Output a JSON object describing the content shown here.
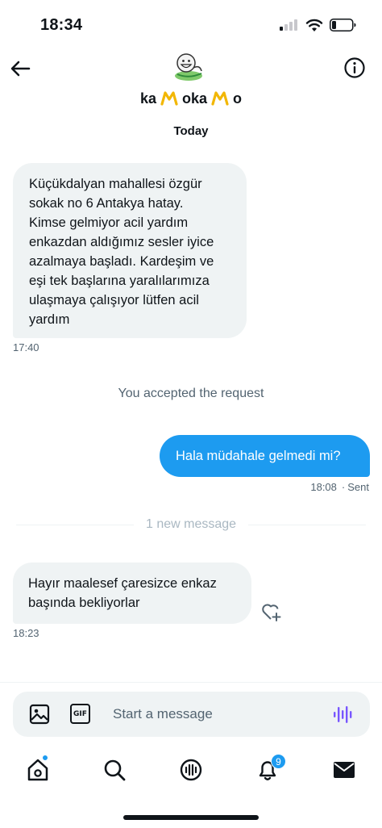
{
  "status_bar": {
    "time": "18:34"
  },
  "header": {
    "avatar_icon": "grinning-sticker-avatar-icon",
    "name_parts": [
      "ka",
      "oka",
      "o"
    ],
    "name_emoji": "yellow-m-icon",
    "info_icon": "info-icon",
    "back_icon": "back-arrow-icon"
  },
  "conversation": {
    "date_label": "Today",
    "messages": [
      {
        "direction": "incoming",
        "lines": [
          "Küçükdalyan mahallesi özgür",
          "sokak no 6 Antakya hatay.",
          "Kimse gelmiyor acil yardım",
          "enkazdan aldığımız sesler iyice",
          "azalmaya başladı. Kardeşim ve",
          "eşi tek başlarına yaralılarımıza",
          "ulaşmaya çalışıyor lütfen acil",
          "yardım"
        ],
        "time": "17:40"
      },
      {
        "direction": "system",
        "text": "You accepted the request"
      },
      {
        "direction": "outgoing",
        "text": "Hala müdahale gelmedi mi?",
        "time": "18:08",
        "status": "Sent"
      },
      {
        "direction": "divider",
        "text": "1 new message"
      },
      {
        "direction": "incoming",
        "lines": [
          "Hayır maalesef çaresizce enkaz",
          "başında bekliyorlar"
        ],
        "time": "18:23"
      }
    ]
  },
  "composer": {
    "placeholder": "Start a message",
    "gif_label": "GIF",
    "image_icon": "image-icon",
    "voice_icon": "voice-wave-icon"
  },
  "bottom_nav": {
    "items": [
      "home-icon",
      "search-icon",
      "spaces-icon",
      "notifications-icon",
      "messages-icon"
    ],
    "notification_count": "9"
  },
  "colors": {
    "accent": "#1d9bf0",
    "incoming_bubble": "#eff3f4",
    "secondary_text": "#536471",
    "primary_text": "#0f1419",
    "voice_accent": "#7856ff"
  }
}
